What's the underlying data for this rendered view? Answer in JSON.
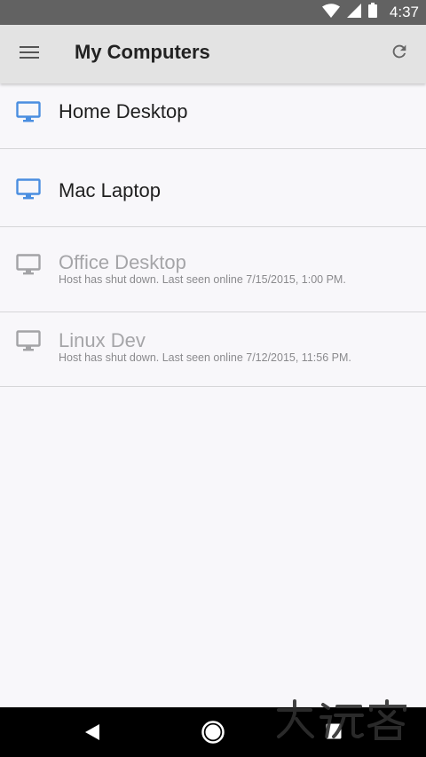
{
  "status_bar": {
    "time": "4:37",
    "icons": [
      "wifi-icon",
      "signal-icon",
      "battery-icon"
    ]
  },
  "app_bar": {
    "title": "My Computers",
    "menu_icon": "hamburger-menu-icon",
    "refresh_icon": "refresh-icon"
  },
  "computers": [
    {
      "name": "Home Desktop",
      "status": "online",
      "icon": "monitor-icon",
      "subtitle": ""
    },
    {
      "name": "Mac Laptop",
      "status": "online",
      "icon": "monitor-icon",
      "subtitle": ""
    },
    {
      "name": "Office Desktop",
      "status": "offline",
      "icon": "monitor-icon",
      "subtitle": "Host has shut down. Last seen online 7/15/2015, 1:00 PM."
    },
    {
      "name": "Linux Dev",
      "status": "offline",
      "icon": "monitor-icon",
      "subtitle": "Host has shut down. Last seen online 7/12/2015, 11:56 PM."
    }
  ],
  "colors": {
    "online_icon": "#4a8ee0",
    "offline_icon": "#a3a3a6",
    "app_bar": "#e3e3e3",
    "status_bar": "#626262",
    "background": "#f8f7fa"
  },
  "nav_bar": {
    "buttons": [
      "back-icon",
      "home-icon",
      "recents-icon"
    ]
  },
  "watermark": {
    "text": "大玩客"
  }
}
